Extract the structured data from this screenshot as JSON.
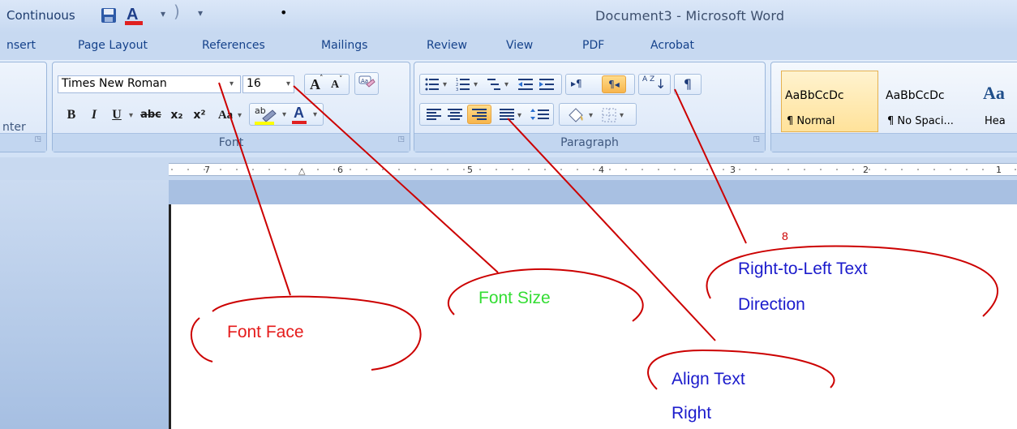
{
  "quick_access": {
    "section_label": "Continuous",
    "customize_symbol": "▾"
  },
  "title_bar": {
    "title": "Document3 - Microsoft Word"
  },
  "tabs": [
    "nsert",
    "Page Layout",
    "References",
    "Mailings",
    "Review",
    "View",
    "PDF",
    "Acrobat"
  ],
  "ribbon": {
    "partial_left_label": "nter",
    "font_group": {
      "label": "Font",
      "font_face": "Times New Roman",
      "font_size": "16",
      "grow_font": "A",
      "shrink_font": "A",
      "bold": "B",
      "italic": "I",
      "underline": "U",
      "strikethrough": "abc",
      "subscript": "x₂",
      "superscript": "x²",
      "change_case": "Aa",
      "highlight": "ab",
      "font_color": "A"
    },
    "paragraph_group": {
      "label": "Paragraph",
      "sort": "A Z",
      "show_marks": "¶"
    },
    "styles": [
      {
        "preview": "AaBbCcDc",
        "name": "¶ Normal"
      },
      {
        "preview": "AaBbCcDc",
        "name": "¶ No Spaci..."
      },
      {
        "preview": "Aa",
        "name": "Hea"
      }
    ]
  },
  "ruler": {
    "numbers": [
      "7",
      "6",
      "5",
      "4",
      "3",
      "2",
      "1"
    ]
  },
  "annotations": [
    {
      "text": "Font Face",
      "color": "#e51b1b"
    },
    {
      "text": "Font Size",
      "color": "#33dd33"
    },
    {
      "text": "Right-to-Left Text",
      "color": "#1b1bcc"
    },
    {
      "text": "Direction",
      "color": "#1b1bcc"
    },
    {
      "text": "Align Text",
      "color": "#1b1bcc"
    },
    {
      "text": "Right",
      "color": "#1b1bcc"
    }
  ],
  "colors": {
    "arrow": "#cc0000",
    "title_text": "#3d4f6d",
    "tab_text": "#15428b"
  }
}
